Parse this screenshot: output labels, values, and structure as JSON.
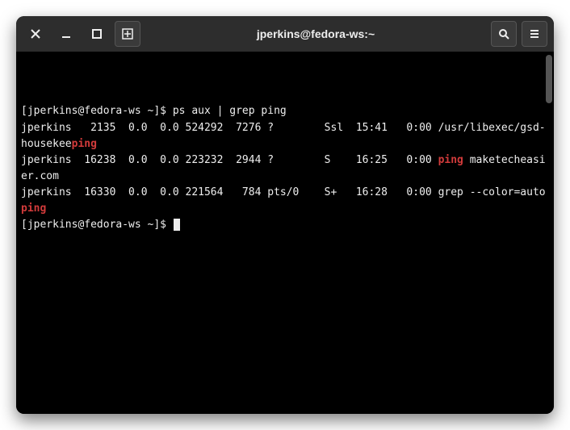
{
  "window": {
    "title": "jperkins@fedora-ws:~"
  },
  "terminal": {
    "prompt1_prefix": "[jperkins@fedora-ws ~]$ ",
    "command": "ps aux | grep ping",
    "rows": [
      {
        "user": "jperkins",
        "pid": "2135",
        "cpu": "0.0",
        "mem": "0.0",
        "vsz": "524292",
        "rss": "7276",
        "tty": "?",
        "stat": "Ssl",
        "start": "15:41",
        "time": "0:00",
        "cmd_pre": "/usr/libexec/gsd-housekee",
        "cmd_hl": "ping",
        "cmd_post": ""
      },
      {
        "user": "jperkins",
        "pid": "16238",
        "cpu": "0.0",
        "mem": "0.0",
        "vsz": "223232",
        "rss": "2944",
        "tty": "?",
        "stat": "S",
        "start": "16:25",
        "time": "0:00",
        "cmd_pre": "",
        "cmd_hl": "ping",
        "cmd_post": " maketecheasier.com"
      },
      {
        "user": "jperkins",
        "pid": "16330",
        "cpu": "0.0",
        "mem": "0.0",
        "vsz": "221564",
        "rss": "784",
        "tty": "pts/0",
        "stat": "S+",
        "start": "16:28",
        "time": "0:00",
        "cmd_pre": "grep --color=auto ",
        "cmd_hl": "ping",
        "cmd_post": ""
      }
    ],
    "prompt2_prefix": "[jperkins@fedora-ws ~]$ "
  }
}
